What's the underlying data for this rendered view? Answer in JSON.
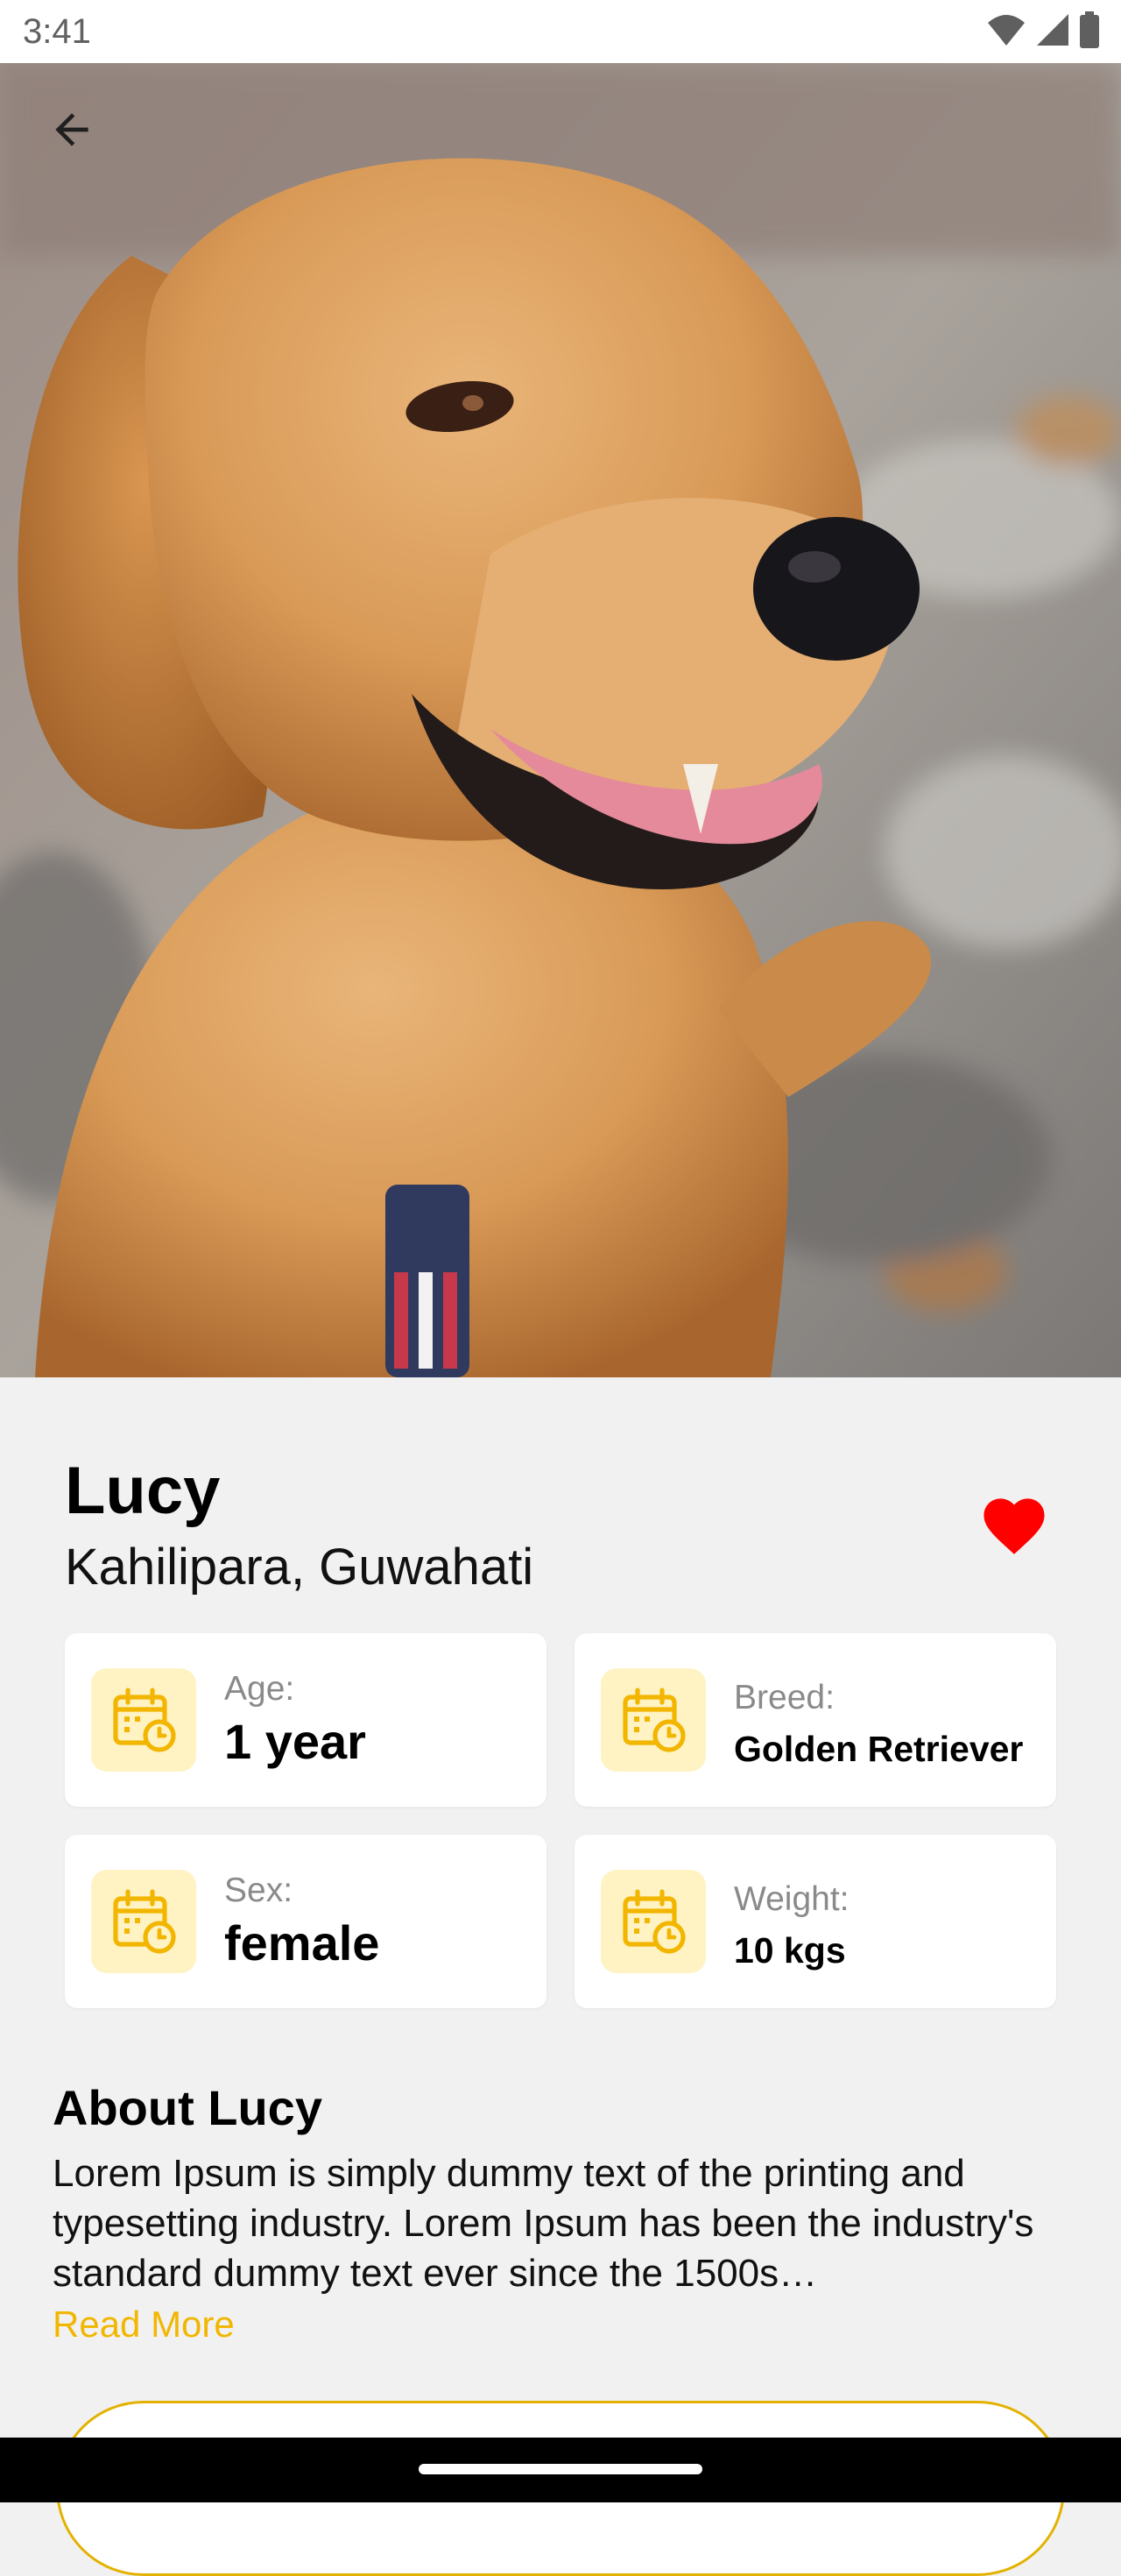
{
  "status_bar": {
    "time": "3:41",
    "icons": [
      "wifi-icon",
      "signal-icon",
      "battery-icon"
    ]
  },
  "header": {
    "back_icon": "arrow-left-icon"
  },
  "pet": {
    "name": "Lucy",
    "location": "Kahilipara, Guwahati",
    "favorite_icon": "heart-icon",
    "favorite_color": "#ff0000"
  },
  "details": [
    {
      "label": "Age:",
      "value": "1 year",
      "icon": "calendar-clock-icon"
    },
    {
      "label": "Breed:",
      "value": "Golden Retriever",
      "icon": "calendar-clock-icon"
    },
    {
      "label": "Sex:",
      "value": "female",
      "icon": "calendar-clock-icon"
    },
    {
      "label": "Weight:",
      "value": "10 kgs",
      "icon": "calendar-clock-icon"
    }
  ],
  "about": {
    "title": "About Lucy",
    "text": "Lorem Ipsum is simply dummy text of the printing and typesetting industry. Lorem Ipsum has been the industry's standard dummy text ever since the 1500s…",
    "read_more": "Read More"
  },
  "colors": {
    "accent": "#f2b600",
    "icon_bg": "#fff3c4",
    "background": "#f1f1f1"
  }
}
